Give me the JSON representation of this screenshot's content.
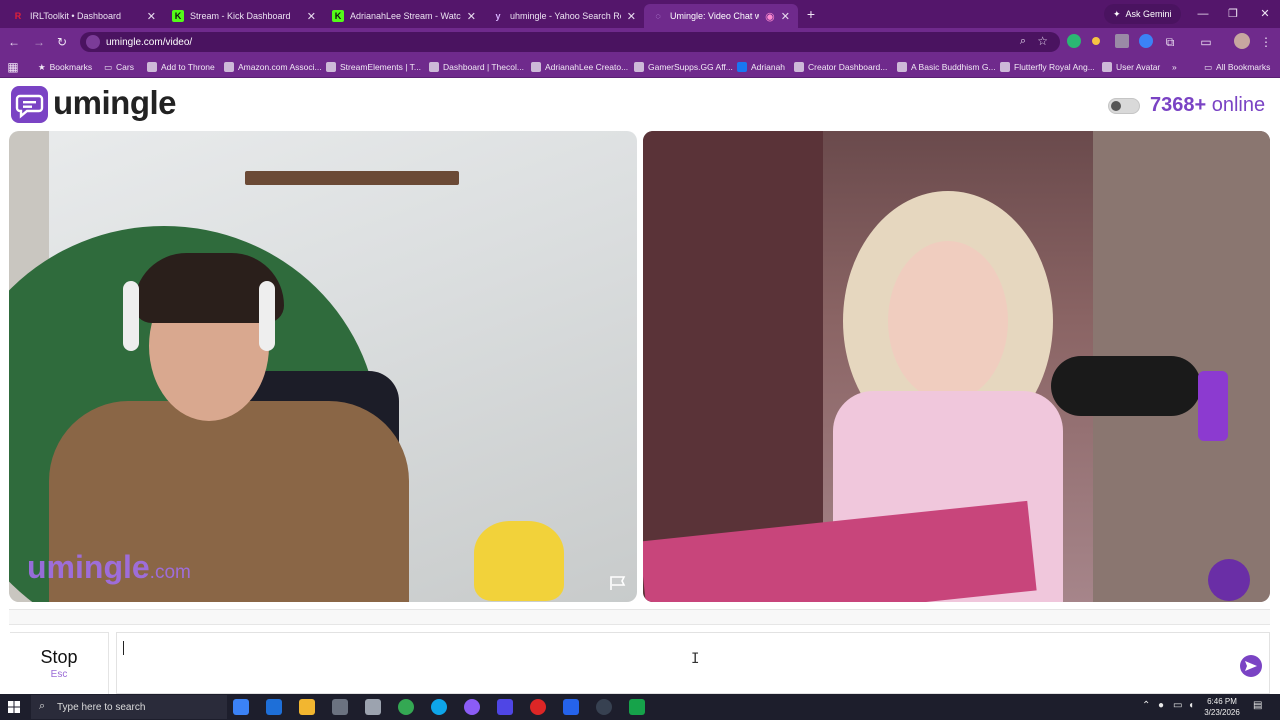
{
  "browser": {
    "tabs": [
      {
        "title": "IRLToolkit • Dashboard",
        "favicon": "irltoolkit-icon",
        "active": false
      },
      {
        "title": "Stream - Kick Dashboard",
        "favicon": "kick-icon",
        "active": false
      },
      {
        "title": "AdrianahLee Stream - Watch Li",
        "favicon": "kick-icon",
        "active": false
      },
      {
        "title": "uhmingle - Yahoo Search Result",
        "favicon": "yahoo-icon",
        "active": false
      },
      {
        "title": "Umingle: Video Chat with S",
        "favicon": "umingle-icon",
        "active": true
      }
    ],
    "ask_gemini": "Ask Gemini",
    "url": "umingle.com/video/",
    "bookmarks": [
      "Bookmarks",
      "Cars",
      "Add to Throne",
      "Amazon.com Associ...",
      "StreamElements | T...",
      "Dashboard | Thecol...",
      "AdrianahLee Creato...",
      "GamerSupps.GG Aff...",
      "Adrianah",
      "Creator Dashboard...",
      "A Basic Buddhism G...",
      "Flutterfly Royal Ang...",
      "User Avatar"
    ],
    "all_bookmarks": "All Bookmarks"
  },
  "page": {
    "logo_text": "umingle",
    "online_count": "7368+",
    "online_word": "online",
    "watermark_name": "umingle",
    "watermark_tld": ".com",
    "stop_label": "Stop",
    "stop_key": "Esc"
  },
  "taskbar": {
    "search_placeholder": "Type here to search",
    "time": "6:46 PM",
    "date": "3/23/2026"
  },
  "colors": {
    "brand": "#7a43c4",
    "chrome_dark": "#54166b",
    "chrome": "#6f2a8c"
  }
}
